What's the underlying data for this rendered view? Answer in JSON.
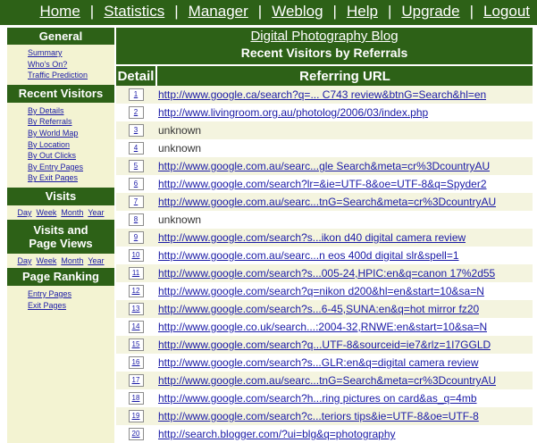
{
  "topnav": {
    "items": [
      "Home",
      "Statistics",
      "Manager",
      "Weblog",
      "Help",
      "Upgrade",
      "Logout"
    ],
    "separator": "|"
  },
  "sidebar": {
    "general": {
      "title": "General",
      "links": [
        "Summary",
        "Who's On?",
        "Traffic Prediction"
      ]
    },
    "recent": {
      "title": "Recent Visitors",
      "links": [
        "By Details",
        "By Referrals",
        "By World Map",
        "By Location",
        "By Out Clicks",
        "By Entry Pages",
        "By Exit Pages"
      ]
    },
    "visits": {
      "title": "Visits",
      "links": [
        "Day",
        "Week",
        "Month",
        "Year"
      ]
    },
    "pageviews": {
      "title_line1": "Visits and",
      "title_line2": "Page Views",
      "links": [
        "Day",
        "Week",
        "Month",
        "Year"
      ]
    },
    "ranking": {
      "title": "Page Ranking",
      "links": [
        "Entry Pages",
        "Exit Pages"
      ]
    }
  },
  "main": {
    "blog_title": "Digital Photography Blog",
    "heading": "Recent Visitors by Referrals",
    "col_detail": "Detail",
    "col_ref": "Referring URL",
    "rows": [
      {
        "num": "1",
        "ref": "http://www.google.ca/search?q=... C743 review&btnG=Search&hl=en",
        "link": true
      },
      {
        "num": "2",
        "ref": "http://www.livingroom.org.au/photolog/2006/03/index.php",
        "link": true
      },
      {
        "num": "3",
        "ref": "unknown",
        "link": false
      },
      {
        "num": "4",
        "ref": "unknown",
        "link": false
      },
      {
        "num": "5",
        "ref": "http://www.google.com.au/searc...gle Search&meta=cr%3DcountryAU",
        "link": true
      },
      {
        "num": "6",
        "ref": "http://www.google.com/search?lr=&ie=UTF-8&oe=UTF-8&q=Spyder2",
        "link": true
      },
      {
        "num": "7",
        "ref": "http://www.google.com.au/searc...tnG=Search&meta=cr%3DcountryAU",
        "link": true
      },
      {
        "num": "8",
        "ref": "unknown",
        "link": false
      },
      {
        "num": "9",
        "ref": "http://www.google.com/search?s...ikon d40 digital camera review",
        "link": true
      },
      {
        "num": "10",
        "ref": "http://www.google.com.au/searc...n eos 400d digital slr&spell=1",
        "link": true
      },
      {
        "num": "11",
        "ref": "http://www.google.com/search?s...005-24,HPIC:en&q=canon 17%2d55",
        "link": true
      },
      {
        "num": "12",
        "ref": "http://www.google.com/search?q=nikon d200&hl=en&start=10&sa=N",
        "link": true
      },
      {
        "num": "13",
        "ref": "http://www.google.com/search?s...6-45,SUNA:en&q=hot mirror fz20",
        "link": true
      },
      {
        "num": "14",
        "ref": "http://www.google.co.uk/search...:2004-32,RNWE:en&start=10&sa=N",
        "link": true
      },
      {
        "num": "15",
        "ref": "http://www.google.com/search?q...UTF-8&sourceid=ie7&rlz=1I7GGLD",
        "link": true
      },
      {
        "num": "16",
        "ref": "http://www.google.com/search?s...GLR:en&q=digital camera review",
        "link": true
      },
      {
        "num": "17",
        "ref": "http://www.google.com.au/searc...tnG=Search&meta=cr%3DcountryAU",
        "link": true
      },
      {
        "num": "18",
        "ref": "http://www.google.com/search?h...ring pictures on card&as_q=4mb",
        "link": true
      },
      {
        "num": "19",
        "ref": "http://www.google.com/search?c...teriors tips&ie=UTF-8&oe=UTF-8",
        "link": true
      },
      {
        "num": "20",
        "ref": "http://search.blogger.com/?ui=blg&q=photography",
        "link": true
      }
    ]
  },
  "colors": {
    "header_green": "#2d6117",
    "sidebar_bg": "#f3f3d2",
    "link_blue": "#1a1aa6",
    "row_alt": "#f4f4df"
  }
}
